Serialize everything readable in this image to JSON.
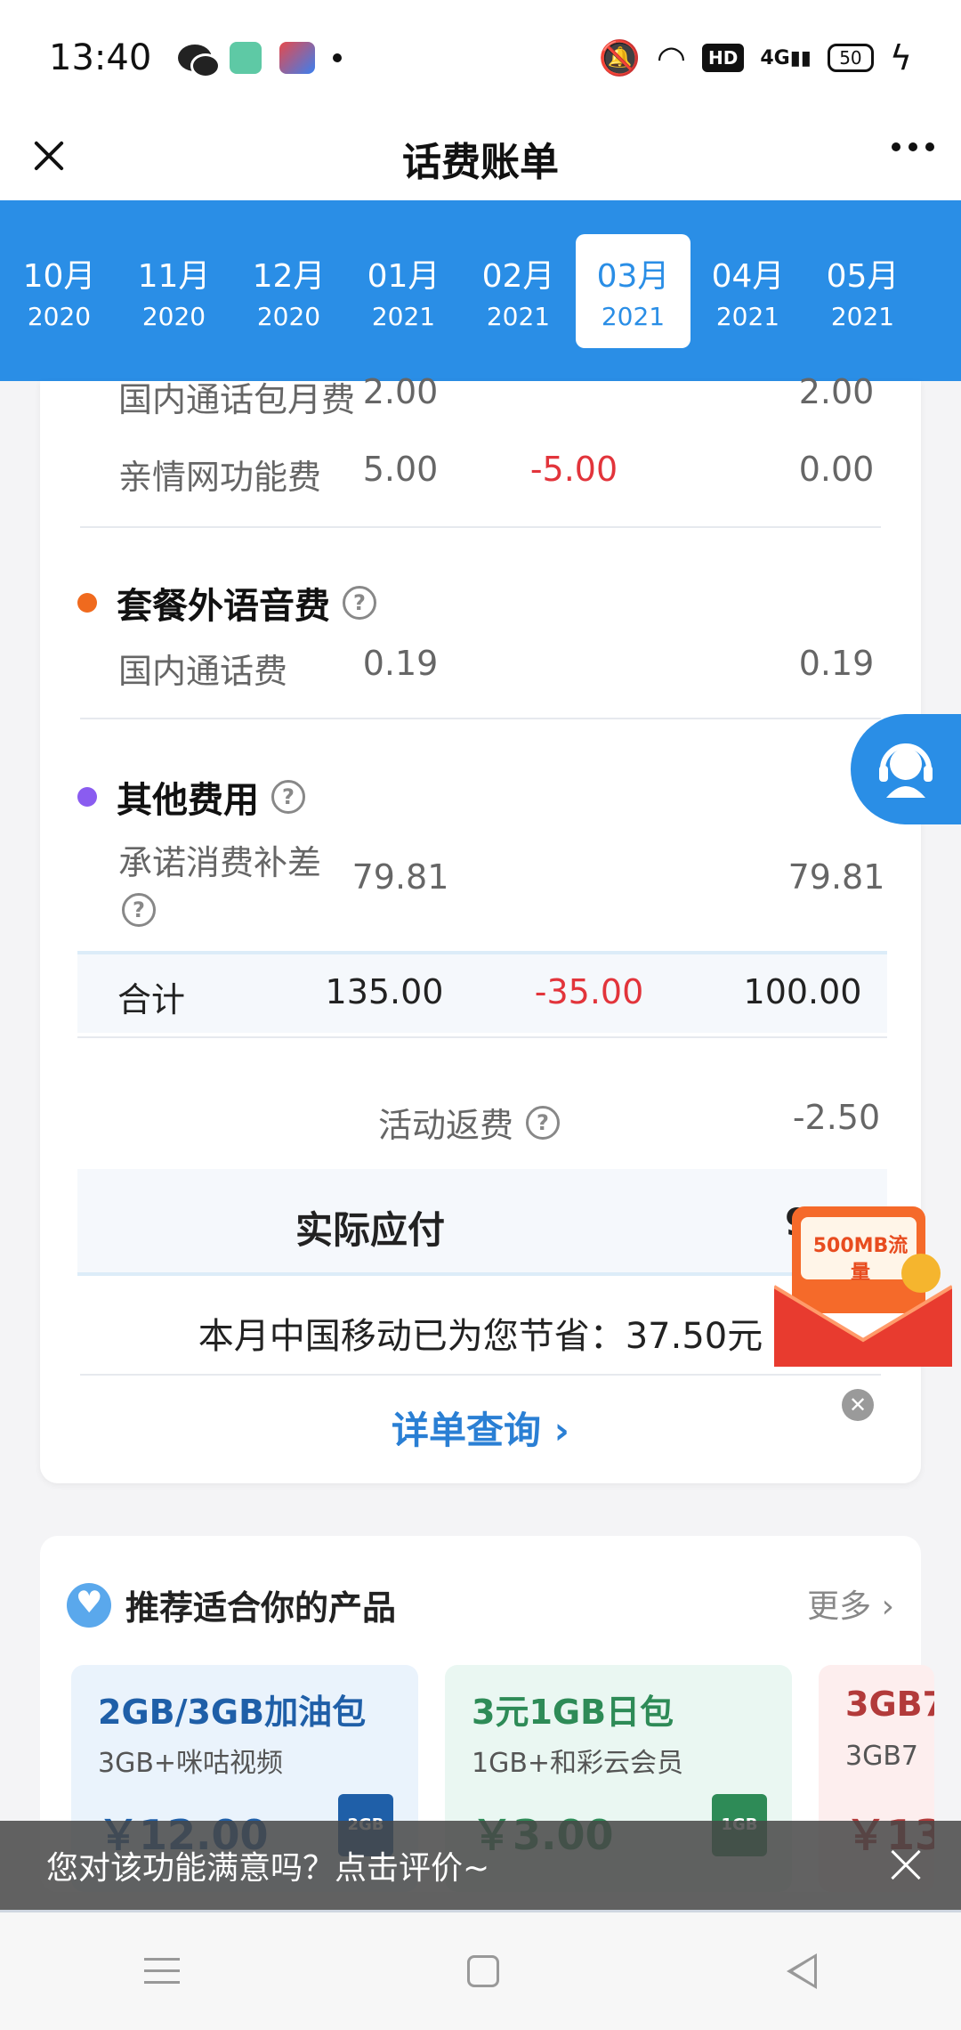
{
  "status_bar": {
    "time": "13:40",
    "network": "4G",
    "battery": "50"
  },
  "header": {
    "title": "话费账单"
  },
  "months": [
    {
      "month": "10月",
      "year": "2020",
      "active": false
    },
    {
      "month": "11月",
      "year": "2020",
      "active": false
    },
    {
      "month": "12月",
      "year": "2020",
      "active": false
    },
    {
      "month": "01月",
      "year": "2021",
      "active": false
    },
    {
      "month": "02月",
      "year": "2021",
      "active": false
    },
    {
      "month": "03月",
      "year": "2021",
      "active": true
    },
    {
      "month": "04月",
      "year": "2021",
      "active": false
    },
    {
      "month": "05月",
      "year": "2021",
      "active": false
    }
  ],
  "bill": {
    "rows_top": [
      {
        "name": "国内通话包月费",
        "amount": "2.00",
        "discount": "",
        "actual": "2.00"
      },
      {
        "name": "亲情网功能费",
        "amount": "5.00",
        "discount": "-5.00",
        "actual": "0.00"
      }
    ],
    "section_voice": {
      "title": "套餐外语音费",
      "row": {
        "name": "国内通话费",
        "amount": "0.19",
        "actual": "0.19"
      }
    },
    "section_other": {
      "title": "其他费用",
      "row": {
        "name": "承诺消费补差",
        "amount": "79.81",
        "actual": "79.81"
      }
    },
    "total": {
      "label": "合计",
      "amount": "135.00",
      "discount": "-35.00",
      "actual": "100.00"
    },
    "rebate": {
      "label": "活动返费",
      "value": "-2.50"
    },
    "payable": {
      "label": "实际应付",
      "value": "97"
    },
    "savings": "本月中国移动已为您节省：37.50元",
    "detail_link": "详单查询"
  },
  "promo": {
    "label": "500MB流量"
  },
  "recommend": {
    "title": "推荐适合你的产品",
    "more": "更多",
    "products": [
      {
        "name": "2GB/3GB加油包",
        "desc": "3GB+咪咕视频",
        "price": "￥12.00",
        "tag": "2GB",
        "color": "#1f5fa8",
        "bg": "#eaf3fc"
      },
      {
        "name": "3元1GB日包",
        "desc": "1GB+和彩云会员",
        "price": "￥3.00",
        "tag": "1GB",
        "color": "#2e8b57",
        "bg": "#eaf7f2"
      },
      {
        "name": "3GB7",
        "desc": "3GB7",
        "price": "￥13",
        "tag": "",
        "color": "#b23a3a",
        "bg": "#fdeeee"
      }
    ]
  },
  "feedback": {
    "text": "您对该功能满意吗？点击评价~"
  },
  "colors": {
    "accent_blue": "#2a8ee6",
    "discount_red": "#e2343b",
    "dot_orange": "#f06a1e",
    "dot_purple": "#8a5cf0"
  }
}
